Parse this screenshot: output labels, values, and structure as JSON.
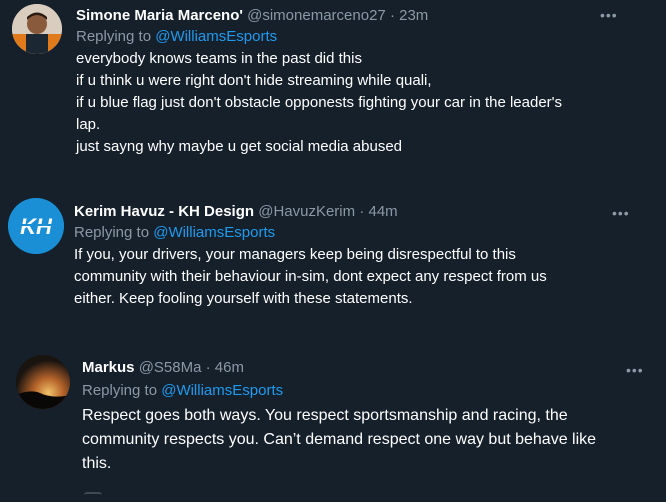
{
  "tweets": [
    {
      "name": "Simone Maria Marceno'",
      "handle": "@simonemarceno27",
      "time": "· 23m",
      "replying_prefix": "Replying to",
      "replying_to": "@WilliamsEsports",
      "lines": [
        "everybody knows teams in the past did this",
        "if u think u were right don't hide streaming while quali,",
        "if u blue flag just don't obstacle opponests fighting your car in the leader's",
        "lap.",
        "just sayng why maybe u get social media abused"
      ],
      "more_icon": "more-horizontal-icon"
    },
    {
      "name": "Kerim Havuz - KH Design",
      "handle": "@HavuzKerim",
      "time": "· 44m",
      "replying_prefix": "Replying to",
      "replying_to": "@WilliamsEsports",
      "lines": [
        "If you, your drivers, your managers keep being disrespectful to this",
        "community with their behaviour in-sim, dont expect any respect from us",
        "either. Keep fooling yourself with these statements."
      ],
      "avatar_logo_text": "KH",
      "more_icon": "more-horizontal-icon"
    },
    {
      "name": "Markus",
      "handle": "@S58Ma",
      "time": "· 46m",
      "replying_prefix": "Replying to",
      "replying_to": "@WilliamsEsports",
      "lines": [
        "Respect goes both ways. You respect sportsmanship and racing, the",
        "community respects you. Can’t demand respect one way but behave like",
        "this."
      ],
      "more_icon": "more-horizontal-icon"
    }
  ],
  "colors": {
    "background": "#15202b",
    "text": "#ffffff",
    "secondary": "#8b98a5",
    "link": "#1d9bf0",
    "kh_avatar_bg": "#1a8fd6"
  }
}
